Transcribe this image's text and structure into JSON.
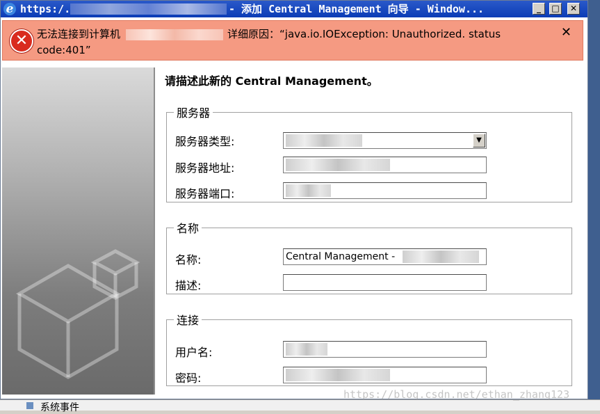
{
  "window": {
    "title_prefix": "https:/.",
    "title_suffix": "- 添加 Central Management 向导 - Window...",
    "minimize": "_",
    "maximize": "□",
    "close": "✕"
  },
  "error": {
    "message_prefix": "无法连接到计算机",
    "message_suffix": "详细原因：“java.io.IOException: Unauthorized. status",
    "message_line2": "code:401”",
    "close": "✕"
  },
  "heading": "请描述此新的 Central Management。",
  "groups": {
    "server": {
      "legend": "服务器",
      "type_label": "服务器类型:",
      "address_label": "服务器地址:",
      "port_label": "服务器端口:"
    },
    "name": {
      "legend": "名称",
      "name_label": "名称:",
      "name_value": "Central Management -",
      "desc_label": "描述:",
      "desc_value": ""
    },
    "connection": {
      "legend": "连接",
      "user_label": "用户名:",
      "password_label": "密码:"
    }
  },
  "background": {
    "event_label": "系统事件",
    "watermark": "https://blog.csdn.net/ethan_zhang123"
  },
  "colors": {
    "titlebar": "#0b3cb6",
    "error_bg": "#f59a82",
    "error_icon": "#d92b1e"
  }
}
